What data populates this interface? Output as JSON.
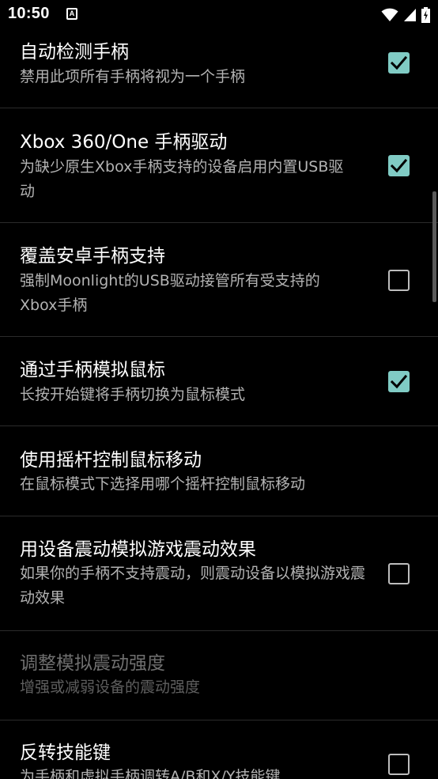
{
  "status_bar": {
    "time": "10:50",
    "notification_icon": "A",
    "icons": [
      "wifi-icon",
      "signal-icon",
      "battery-icon"
    ]
  },
  "colors": {
    "background": "#000000",
    "checkbox_accent": "#80cbc4",
    "summary_text": "#b3b3b3",
    "disabled_text": "#6f6f6f"
  },
  "settings": [
    {
      "title": "自动检测手柄",
      "summary": "禁用此项所有手柄将视为一个手柄",
      "checkbox": "checked",
      "enabled": true
    },
    {
      "title": "Xbox 360/One 手柄驱动",
      "summary": "为缺少原生Xbox手柄支持的设备启用内置USB驱动",
      "checkbox": "checked",
      "enabled": true
    },
    {
      "title": "覆盖安卓手柄支持",
      "summary": "强制Moonlight的USB驱动接管所有受支持的Xbox手柄",
      "checkbox": "unchecked",
      "enabled": true
    },
    {
      "title": "通过手柄模拟鼠标",
      "summary": "长按开始键将手柄切换为鼠标模式",
      "checkbox": "checked",
      "enabled": true
    },
    {
      "title": "使用摇杆控制鼠标移动",
      "summary": "在鼠标模式下选择用哪个摇杆控制鼠标移动",
      "checkbox": "none",
      "enabled": true
    },
    {
      "title": "用设备震动模拟游戏震动效果",
      "summary": "如果你的手柄不支持震动，则震动设备以模拟游戏震动效果",
      "checkbox": "unchecked",
      "enabled": true
    },
    {
      "title": "调整模拟震动强度",
      "summary": "增强或减弱设备的震动强度",
      "checkbox": "none",
      "enabled": false
    },
    {
      "title": "反转技能键",
      "summary": "为手柄和虚拟手柄调转A/B和X/Y技能键",
      "checkbox": "unchecked",
      "enabled": true
    }
  ]
}
